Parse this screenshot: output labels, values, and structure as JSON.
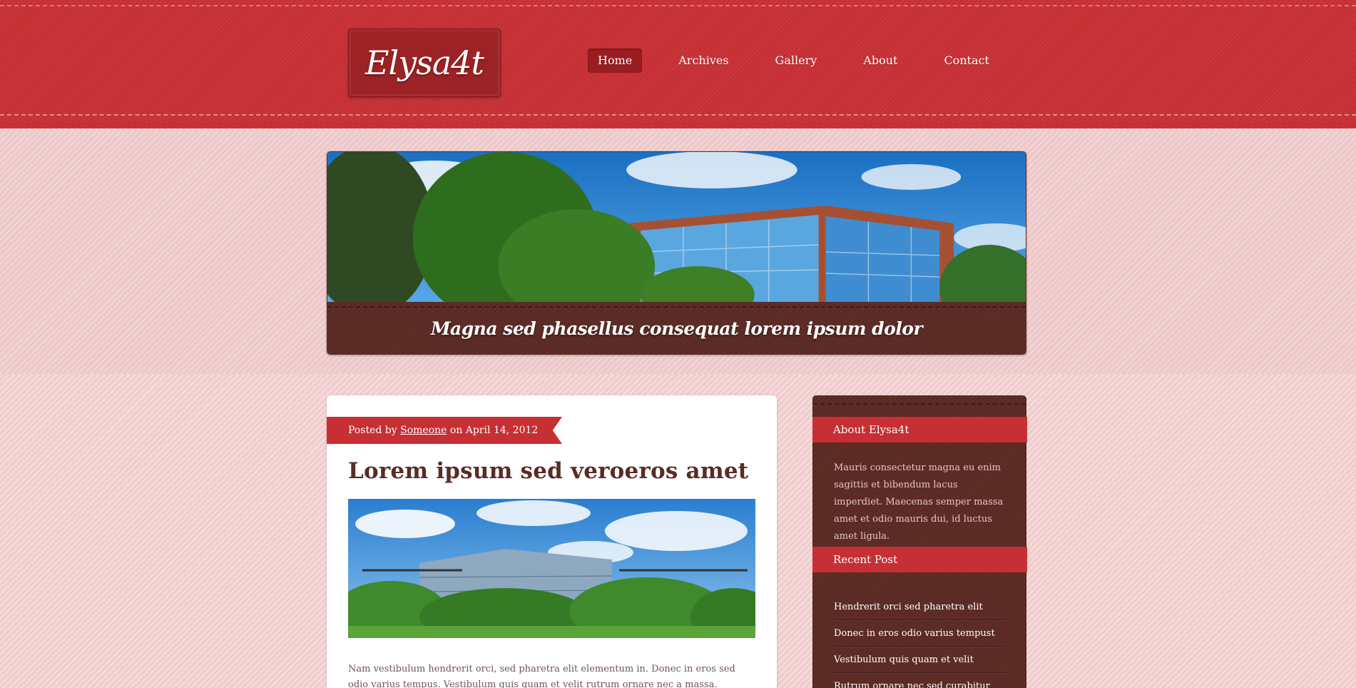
{
  "site": {
    "logo": "Elysa4t"
  },
  "nav": [
    {
      "label": "Home",
      "active": true
    },
    {
      "label": "Archives"
    },
    {
      "label": "Gallery"
    },
    {
      "label": "About"
    },
    {
      "label": "Contact"
    }
  ],
  "banner": {
    "caption": "Magna sed phasellus consequat lorem ipsum dolor"
  },
  "post": {
    "meta_prefix": "Posted by",
    "author": "Someone",
    "meta_mid": "on",
    "date": "April 14, 2012",
    "title": "Lorem ipsum sed veroeros amet",
    "body": "Nam vestibulum hendrerit orci, sed pharetra elit elementum in. Donec in eros sed odio varius tempus. Vestibulum quis quam et velit rutrum ornare nec a massa. Curabitur malesuada"
  },
  "sidebar": {
    "about": {
      "heading": "About Elysa4t",
      "text": "Mauris consectetur magna eu enim sagittis et bibendum lacus imperdiet. Maecenas semper massa amet et odio mauris dui, id luctus amet ligula."
    },
    "recent": {
      "heading": "Recent Post",
      "items": [
        "Hendrerit orci sed pharetra elit",
        "Donec in eros odio varius tempust",
        "Vestibulum quis quam et velit",
        "Rutrum ornare nec sed curabitur"
      ]
    }
  },
  "colors": {
    "primary_red": "#c62f33",
    "dark_brown": "#5f2d27",
    "pink_bg": "#f0cccc"
  }
}
